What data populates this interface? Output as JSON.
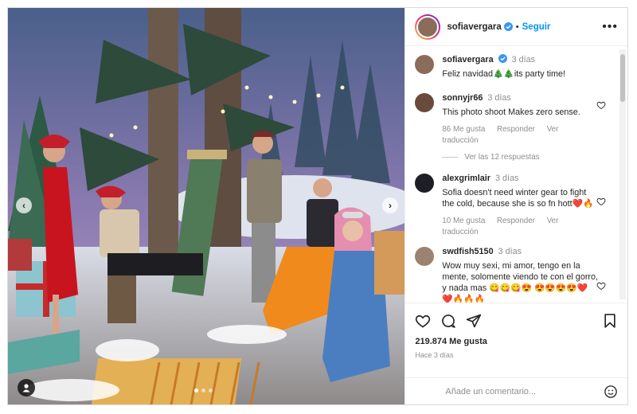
{
  "post": {
    "author": "sofiavergara",
    "follow_label": "Seguir",
    "more_label": "•••",
    "caption_time": "3 días",
    "caption_text": "Feliz navidad🎄🎄its party time!"
  },
  "comments": [
    {
      "user": "sonnyjr66",
      "time": "3 días",
      "text": "This photo shoot Makes zero sense.",
      "likes": "86 Me gusta",
      "reply_label": "Responder",
      "translate_label": "Ver traducción",
      "view_replies": "Ver las 12 respuestas"
    },
    {
      "user": "alexgrimlair",
      "time": "3 días",
      "text": "Sofia doesn't need winter gear to fight the cold, because she is so fn hott❤️🔥",
      "likes": "10 Me gusta",
      "reply_label": "Responder",
      "translate_label": "Ver traducción"
    },
    {
      "user": "swdfish5150",
      "time": "3 días",
      "text": "Wow muy sexi, mi amor, tengo en la mente, solomente viendo te con el gorro, y nada mas 😋😋😋😍 😍😍😍😍❤️❤️🔥🔥🔥"
    }
  ],
  "stats": {
    "likes": "219.874 Me gusta",
    "ago": "Hace 3 días"
  },
  "composer": {
    "placeholder": "Añade un comentario..."
  },
  "icons": {
    "heart": "heart-icon",
    "comment": "comment-icon",
    "share": "send-icon",
    "save": "bookmark-icon",
    "emoji": "emoji-icon",
    "tag": "person-tag-icon",
    "verified": "verified-badge-icon"
  },
  "colors": {
    "follow_blue": "#0095f6",
    "verified_blue": "#3897f0"
  }
}
